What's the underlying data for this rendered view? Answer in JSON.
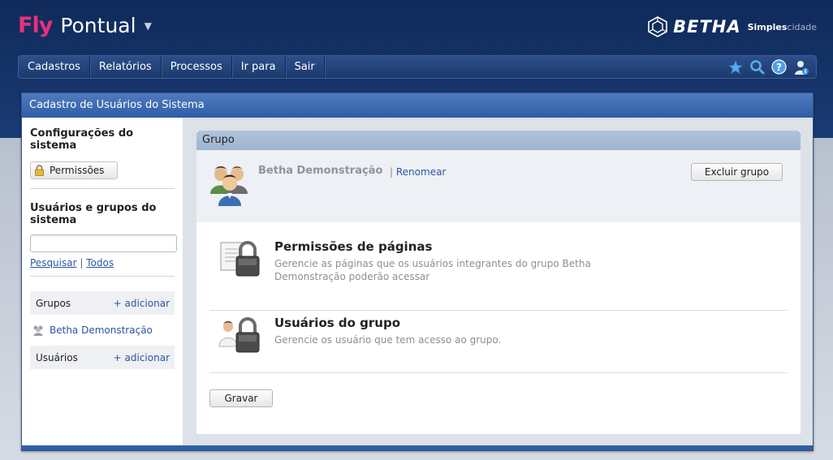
{
  "app": {
    "brand_fly": "Fly",
    "brand_name": "Pontual",
    "vendor_name": "BETHA",
    "vendor_tag_a": "Simples",
    "vendor_tag_b": "cidade"
  },
  "menu": {
    "items": [
      {
        "label": "Cadastros"
      },
      {
        "label": "Relatórios"
      },
      {
        "label": "Processos"
      },
      {
        "label": "Ir para"
      },
      {
        "label": "Sair"
      }
    ],
    "icons": [
      "star-icon",
      "search-icon",
      "help-icon",
      "user-info-icon"
    ]
  },
  "window": {
    "title": "Cadastro de Usuários do Sistema"
  },
  "sidebar": {
    "config_heading": "Configurações do sistema",
    "permissions_button": "Permissões",
    "users_heading": "Usuários e grupos do sistema",
    "search_value": "",
    "search_link": "Pesquisar",
    "link_separator": "|",
    "all_link": "Todos",
    "groups_label": "Grupos",
    "groups_add": "+ adicionar",
    "group_items": [
      {
        "label": "Betha Demonstração"
      }
    ],
    "users_label": "Usuários",
    "users_add": "+ adicionar"
  },
  "panel": {
    "title": "Grupo",
    "group_name": "Betha Demonstração",
    "rename_separator": "|",
    "rename_link": "Renomear",
    "delete_button": "Excluir grupo",
    "sections": [
      {
        "title": "Permissões de páginas",
        "description": "Gerencie as páginas que os usuários integrantes do grupo Betha Demonstração poderão acessar"
      },
      {
        "title": "Usuários do grupo",
        "description": "Gerencie os usuário que tem acesso ao grupo."
      }
    ],
    "save_button": "Gravar"
  },
  "colors": {
    "brand_pink": "#e8317a",
    "header_navy": "#0f2a5a",
    "link_blue": "#2b56a3",
    "title_bar_blue": "#2e5ea6"
  }
}
